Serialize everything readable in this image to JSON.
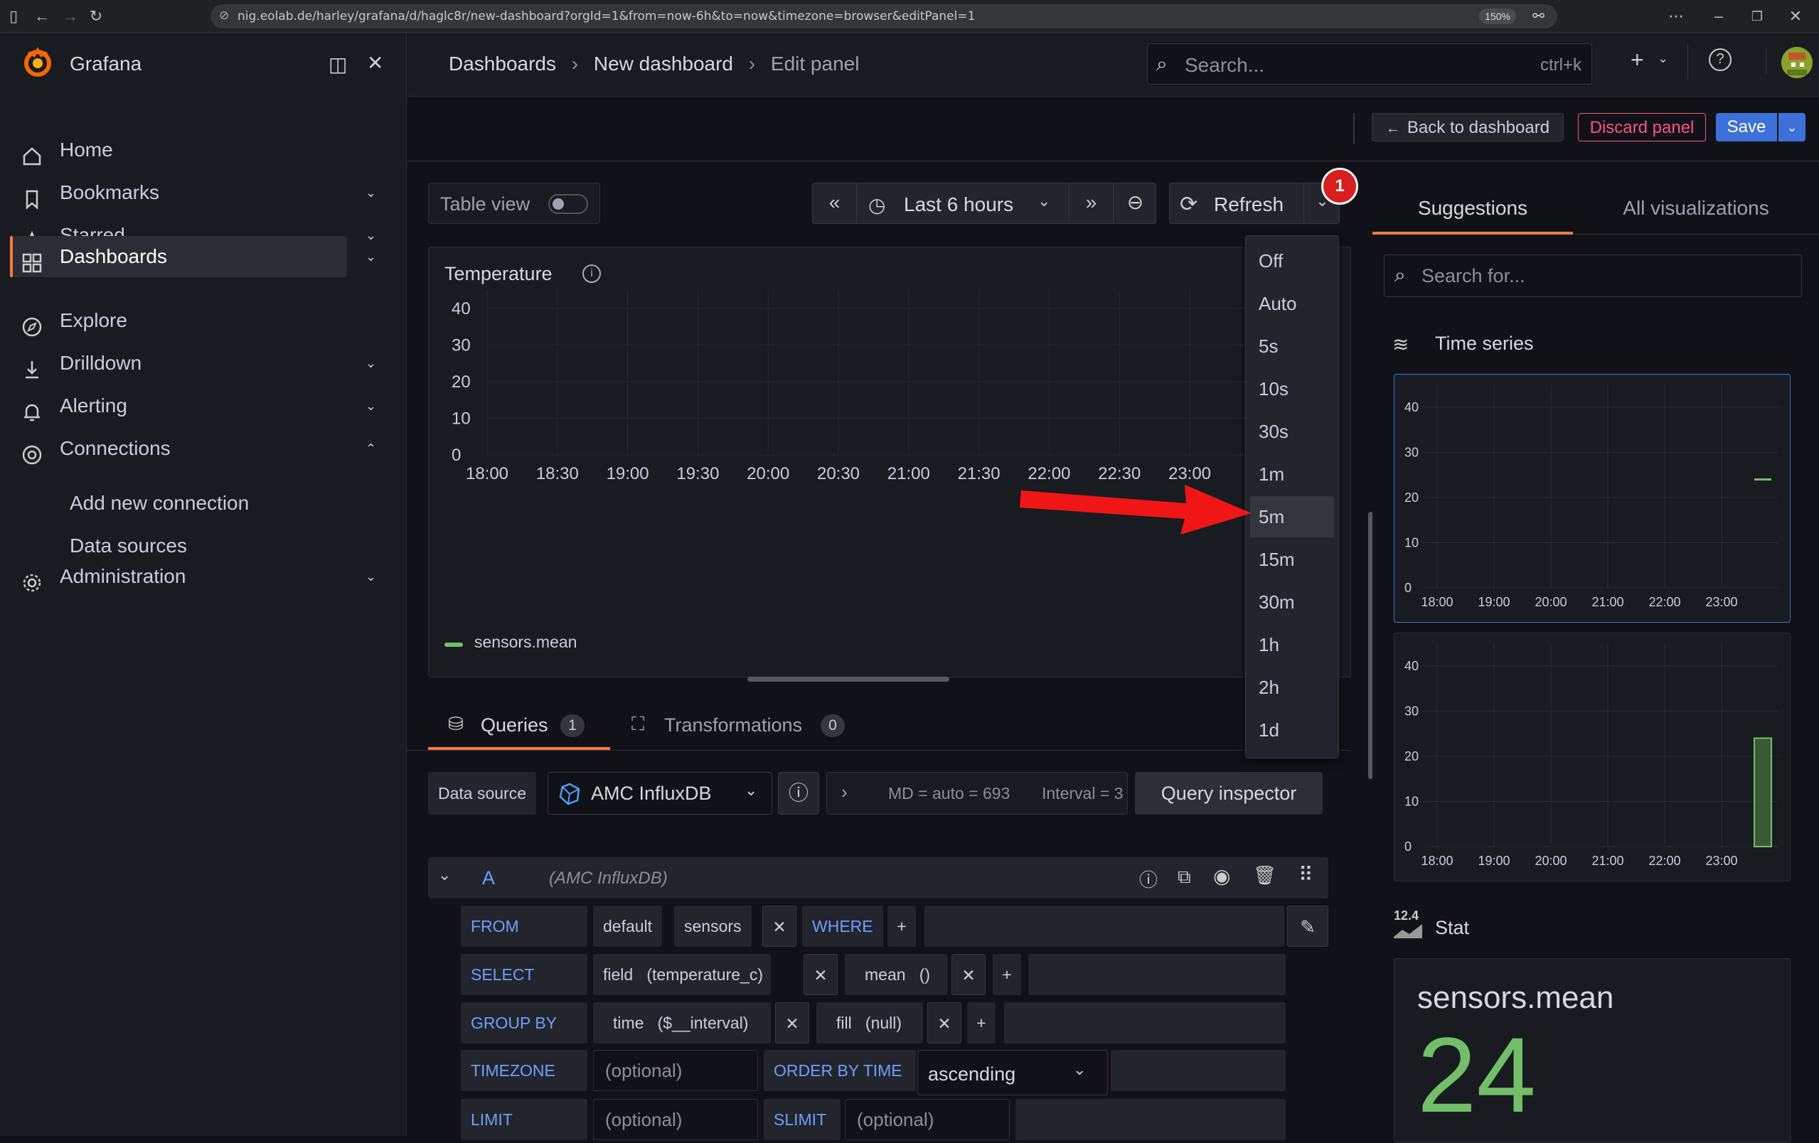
{
  "browser": {
    "url": "nig.eolab.de/harley/grafana/d/haglc8r/new-dashboard?orgId=1&from=now-6h&to=now&timezone=browser&editPanel=1",
    "zoom": "150%"
  },
  "app": {
    "name": "Grafana"
  },
  "breadcrumb": {
    "dashboards": "Dashboards",
    "dashboard": "New dashboard",
    "current": "Edit panel"
  },
  "search": {
    "placeholder": "Search...",
    "shortcut": "ctrl+k"
  },
  "nav": {
    "items": [
      {
        "label": "Home"
      },
      {
        "label": "Bookmarks"
      },
      {
        "label": "Starred"
      },
      {
        "label": "Dashboards"
      },
      {
        "label": "Explore"
      },
      {
        "label": "Drilldown"
      },
      {
        "label": "Alerting"
      },
      {
        "label": "Connections"
      },
      {
        "label": "Add new connection"
      },
      {
        "label": "Data sources"
      },
      {
        "label": "Administration"
      }
    ]
  },
  "actions": {
    "back": "Back to dashboard",
    "discard": "Discard panel",
    "save": "Save"
  },
  "toolbar": {
    "table_view": "Table view",
    "time_range": "Last 6 hours",
    "refresh": "Refresh",
    "badge": "1"
  },
  "refresh_options": [
    "Off",
    "Auto",
    "5s",
    "10s",
    "30s",
    "1m",
    "5m",
    "15m",
    "30m",
    "1h",
    "2h",
    "1d"
  ],
  "refresh_selected": "5m",
  "panel": {
    "title": "Temperature",
    "legend": "sensors.mean"
  },
  "chart_data": {
    "type": "line",
    "title": "Temperature",
    "x": [
      "18:00",
      "18:30",
      "19:00",
      "19:30",
      "20:00",
      "20:30",
      "21:00",
      "21:30",
      "22:00",
      "22:30",
      "23:00"
    ],
    "yticks": [
      "0",
      "10",
      "20",
      "30",
      "40"
    ],
    "ylim": [
      0,
      45
    ],
    "series": [
      {
        "name": "sensors.mean",
        "values": []
      }
    ],
    "grid": true,
    "legend": "bottom-left"
  },
  "tabs": {
    "queries": "Queries",
    "queries_count": "1",
    "transformations": "Transformations",
    "transformations_count": "0"
  },
  "query": {
    "ds_label": "Data source",
    "ds_name": "AMC InfluxDB",
    "md": "MD = auto = 693",
    "interval": "Interval = 3",
    "inspector": "Query inspector",
    "ref": "A",
    "ref_ds": "(AMC InfluxDB)",
    "from": "FROM",
    "from_db": "default",
    "from_meas": "sensors",
    "where": "WHERE",
    "select": "SELECT",
    "field": "field",
    "field_arg": "(temperature_c)",
    "mean": "mean",
    "mean_arg": "()",
    "groupby": "GROUP BY",
    "time": "time",
    "time_arg": "($__interval)",
    "fill": "fill",
    "fill_arg": "(null)",
    "timezone": "TIMEZONE",
    "optional": "(optional)",
    "orderby": "ORDER BY TIME",
    "order": "ascending",
    "limit": "LIMIT",
    "slimit": "SLIMIT",
    "plus": "+"
  },
  "right": {
    "tab1": "Suggestions",
    "tab2": "All visualizations",
    "search": "Search for...",
    "ts_label": "Time series",
    "stat_label": "Stat",
    "stat_icon": "12.4",
    "stat_name": "sensors.mean",
    "stat_value": "24",
    "mini_x": [
      "18:00",
      "19:00",
      "20:00",
      "21:00",
      "22:00",
      "23:00"
    ],
    "mini_y": [
      "0",
      "10",
      "20",
      "30",
      "40"
    ]
  },
  "colors": {
    "accent": "#ff7a3b",
    "primary": "#3d71d9",
    "danger": "#ff5286",
    "green": "#73bf69"
  }
}
